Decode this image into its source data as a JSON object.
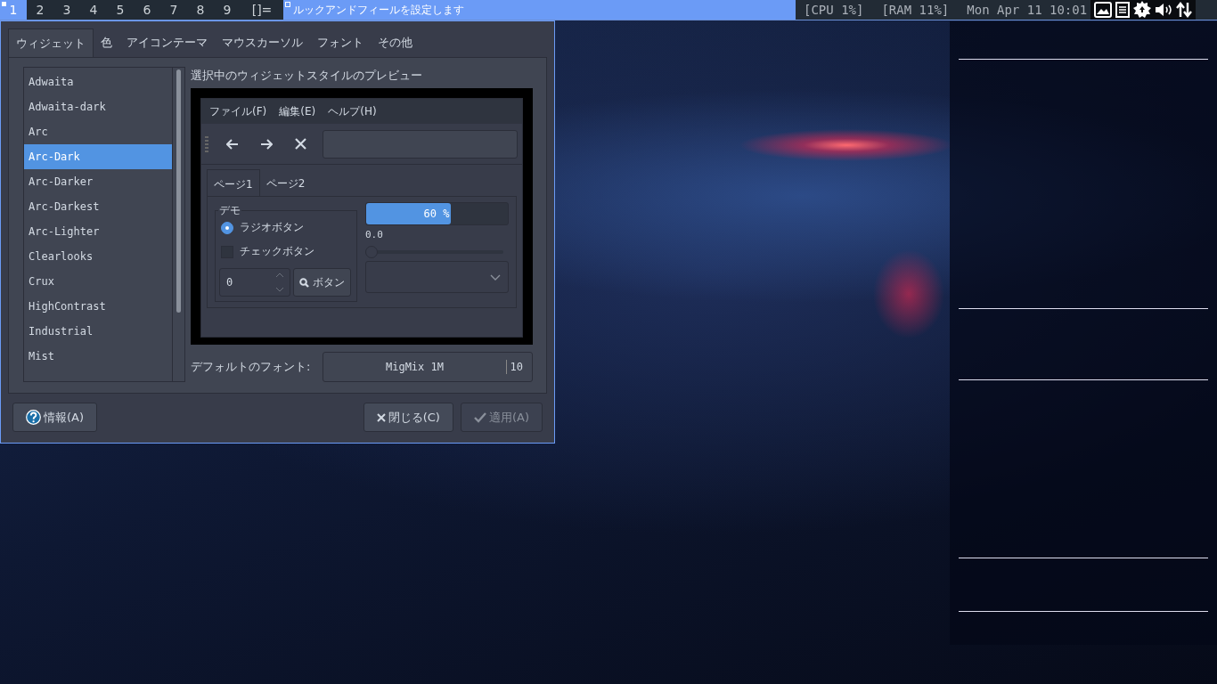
{
  "top_bar": {
    "workspaces": [
      {
        "label": "1",
        "selected": true
      },
      {
        "label": "2",
        "selected": false
      },
      {
        "label": "3",
        "selected": false
      },
      {
        "label": "4",
        "selected": false
      },
      {
        "label": "5",
        "selected": false
      },
      {
        "label": "6",
        "selected": false
      },
      {
        "label": "7",
        "selected": false
      },
      {
        "label": "8",
        "selected": false
      },
      {
        "label": "9",
        "selected": false
      }
    ],
    "layout_symbol": "[]=",
    "window_title": "ルックアンドフィールを設定します",
    "status": [
      "[CPU 1%]",
      "[RAM 11%]",
      "Mon Apr 11 10:01"
    ]
  },
  "dialog": {
    "tabs": [
      {
        "label": "ウィジェット",
        "selected": true
      },
      {
        "label": "色",
        "selected": false
      },
      {
        "label": "アイコンテーマ",
        "selected": false
      },
      {
        "label": "マウスカーソル",
        "selected": false
      },
      {
        "label": "フォント",
        "selected": false
      },
      {
        "label": "その他",
        "selected": false
      }
    ],
    "themes": [
      {
        "label": "Adwaita",
        "selected": false
      },
      {
        "label": "Adwaita-dark",
        "selected": false
      },
      {
        "label": "Arc",
        "selected": false
      },
      {
        "label": "Arc-Dark",
        "selected": true
      },
      {
        "label": "Arc-Darker",
        "selected": false
      },
      {
        "label": "Arc-Darkest",
        "selected": false
      },
      {
        "label": "Arc-Lighter",
        "selected": false
      },
      {
        "label": "Clearlooks",
        "selected": false
      },
      {
        "label": "Crux",
        "selected": false
      },
      {
        "label": "HighContrast",
        "selected": false
      },
      {
        "label": "Industrial",
        "selected": false
      },
      {
        "label": "Mist",
        "selected": false
      }
    ],
    "preview_title": "選択中のウィジェットスタイルのプレビュー",
    "preview": {
      "menu": [
        "ファイル(F)",
        "編集(E)",
        "ヘルプ(H)"
      ],
      "tabs": [
        {
          "label": "ページ1",
          "selected": true
        },
        {
          "label": "ページ2",
          "selected": false
        }
      ],
      "group_title": "デモ",
      "radio": {
        "label": "ラジオボタン",
        "checked": true
      },
      "checkbox": {
        "label": "チェックボタン",
        "checked": false
      },
      "spin_value": "0",
      "button": "ボタン",
      "progress": {
        "level": 0.6,
        "reading": "60 %"
      },
      "slider": {
        "level": 0,
        "reading": "0.0"
      }
    },
    "font_label": "デフォルトのフォント:",
    "font_name": "MigMix 1M",
    "font_size": "10",
    "buttons": [
      {
        "label": "情報(A)",
        "kind": "about",
        "disabled": false
      },
      {
        "label": "閉じる(C)",
        "kind": "close",
        "disabled": false
      },
      {
        "label": "適用(A)",
        "kind": "apply",
        "disabled": true
      }
    ]
  }
}
